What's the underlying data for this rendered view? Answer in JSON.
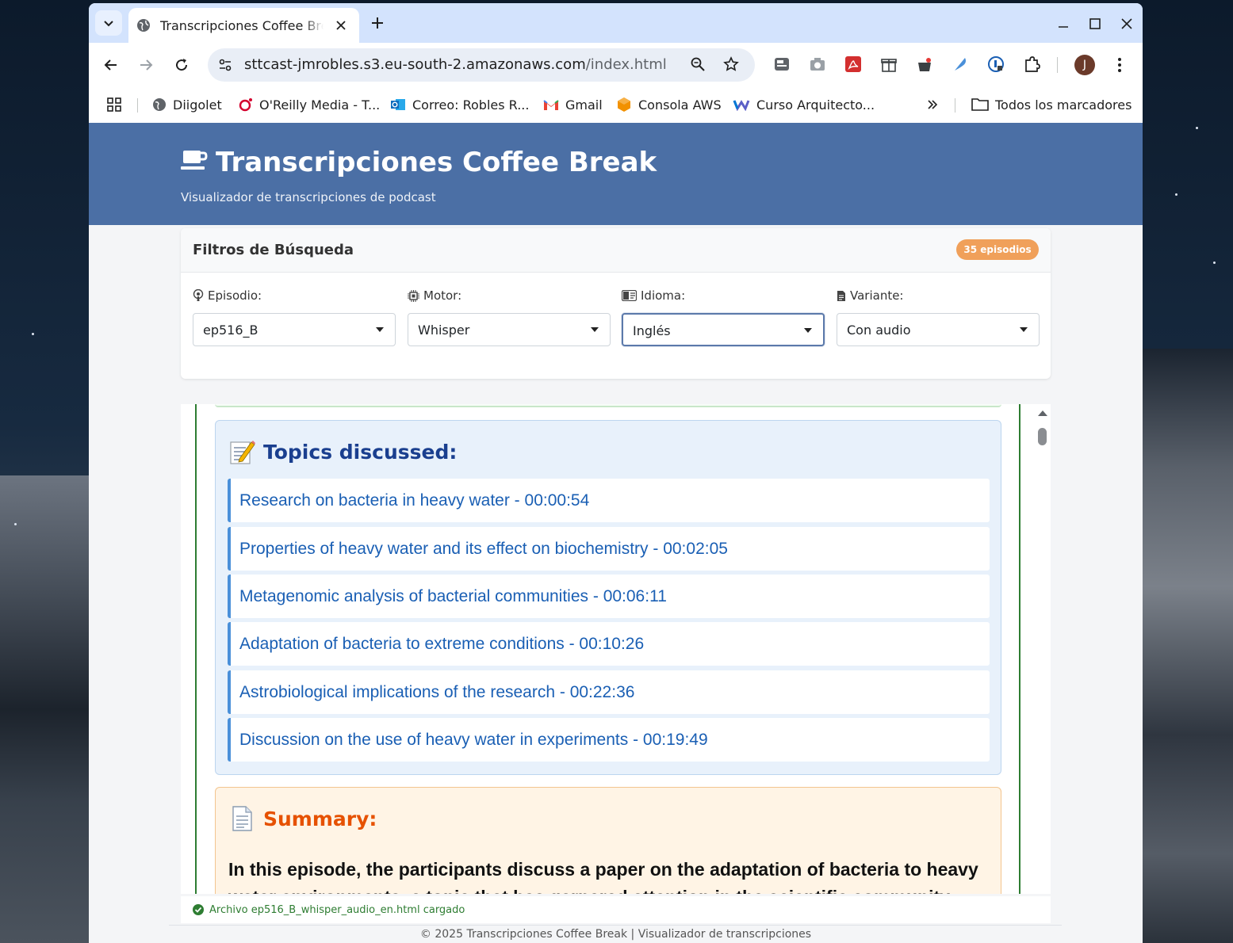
{
  "browser": {
    "tab_title": "Transcripciones Coffee Break",
    "url_host": "sttcast-jmrobles.s3.eu-south-2.amazonaws.com",
    "url_path": "/index.html",
    "profile_initial": "J",
    "bookmarks": [
      {
        "label": "Diigolet",
        "icon": "globe-icon"
      },
      {
        "label": "O'Reilly Media - T...",
        "icon": "oreilly-icon"
      },
      {
        "label": "Correo: Robles R...",
        "icon": "outlook-icon"
      },
      {
        "label": "Gmail",
        "icon": "gmail-icon"
      },
      {
        "label": "Consola AWS",
        "icon": "aws-icon"
      },
      {
        "label": "Curso Arquitecto...",
        "icon": "course-icon"
      }
    ],
    "all_bookmarks_label": "Todos los marcadores"
  },
  "header": {
    "title": "Transcripciones Coffee Break",
    "subtitle": "Visualizador de transcripciones de podcast"
  },
  "filters": {
    "title": "Filtros de Búsqueda",
    "count_badge": "35 episodios",
    "fields": [
      {
        "label": "Episodio:",
        "icon": "podcast-icon",
        "value": "ep516_B"
      },
      {
        "label": "Motor:",
        "icon": "chip-icon",
        "value": "Whisper"
      },
      {
        "label": "Idioma:",
        "icon": "language-icon",
        "value": "Inglés"
      },
      {
        "label": "Variante:",
        "icon": "file-icon",
        "value": "Con audio"
      }
    ]
  },
  "topics": {
    "title": "Topics discussed:",
    "items": [
      "Research on bacteria in heavy water - 00:00:54",
      "Properties of heavy water and its effect on biochemistry - 00:02:05",
      "Metagenomic analysis of bacterial communities - 00:06:11",
      "Adaptation of bacteria to extreme conditions - 00:10:26",
      "Astrobiological implications of the research - 00:22:36",
      "Discussion on the use of heavy water in experiments - 00:19:49"
    ]
  },
  "summary": {
    "title": "Summary:",
    "text": "In this episode, the participants discuss a paper on the adaptation of bacteria to heavy water environments, a topic that has garnered attention in the scientific community. Juan Carlos Gil"
  },
  "status": {
    "message": "Archivo ep516_B_whisper_audio_en.html cargado"
  },
  "footer": {
    "text": "© 2025 Transcripciones Coffee Break | Visualizador de transcripciones"
  },
  "colors": {
    "header_bg": "#4b6fa5",
    "badge_bg": "#f0a05a",
    "topic_link": "#1a5fb4",
    "summary_title": "#e65100",
    "status_ok": "#2e7d32"
  }
}
